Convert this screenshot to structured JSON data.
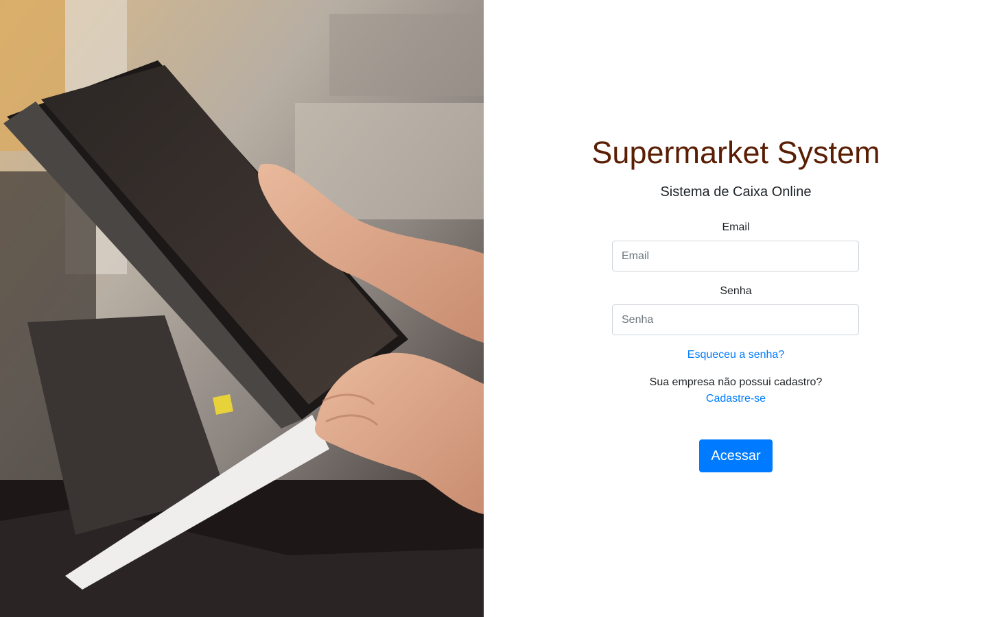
{
  "hero_image": {
    "description_icon": "cashier-pos-terminal-photo"
  },
  "login": {
    "title": "Supermarket System",
    "subtitle": "Sistema de Caixa Online",
    "email_label": "Email",
    "email_placeholder": "Email",
    "email_value": "",
    "password_label": "Senha",
    "password_placeholder": "Senha",
    "password_value": "",
    "forgot_password_link": "Esqueceu a senha?",
    "register_prompt": "Sua empresa não possui cadastro?",
    "register_link": "Cadastre-se",
    "submit_label": "Acessar"
  },
  "colors": {
    "title": "#5a1e04",
    "accent": "#007bff",
    "text": "#212529",
    "input_border": "#ced4da"
  }
}
